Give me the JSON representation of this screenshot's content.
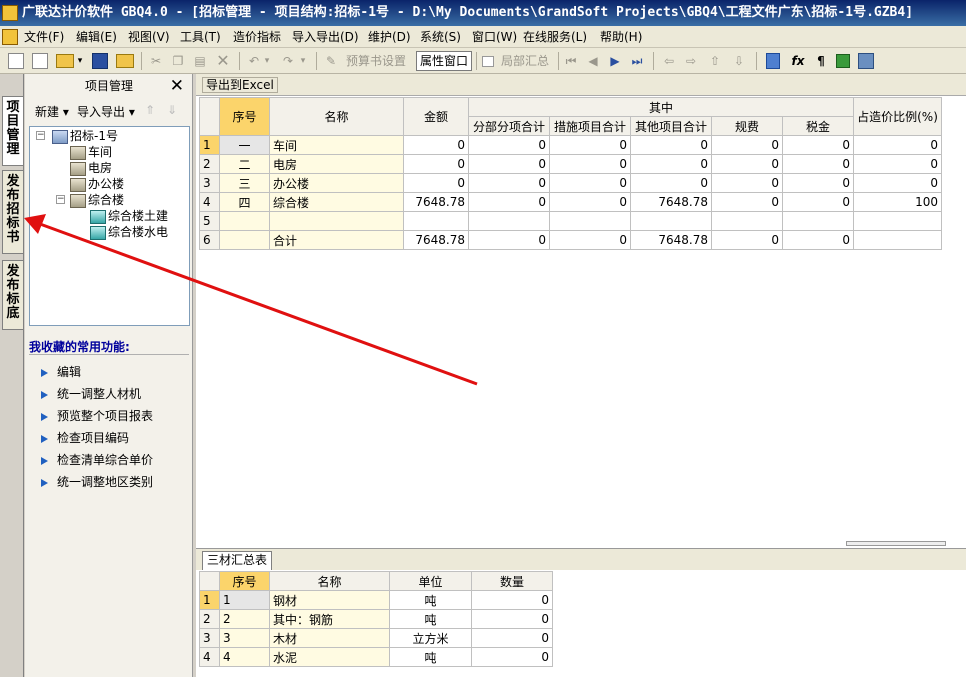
{
  "window": {
    "title": "广联达计价软件 GBQ4.0 - [招标管理 - 项目结构:招标-1号 - D:\\My Documents\\GrandSoft Projects\\GBQ4\\工程文件广东\\招标-1号.GZB4]"
  },
  "menu": {
    "items": [
      {
        "label": "文件(F)"
      },
      {
        "label": "编辑(E)"
      },
      {
        "label": "视图(V)"
      },
      {
        "label": "工具(T)"
      },
      {
        "label": "造价指标"
      },
      {
        "label": "导入导出(D)"
      },
      {
        "label": "维护(D)"
      },
      {
        "label": "系统(S)"
      },
      {
        "label": "窗口(W)"
      },
      {
        "label": "在线服务(L)"
      },
      {
        "label": "帮助(H)"
      }
    ]
  },
  "toolbar": {
    "budget_settings": "预算书设置",
    "properties_window": "属性窗口",
    "partial_summary": "局部汇总",
    "fx": "fx",
    "pilcrow": "¶"
  },
  "side_tabs": [
    {
      "label": "项目管理"
    },
    {
      "label": "发布招标书"
    },
    {
      "label": "发布标底"
    }
  ],
  "panel": {
    "title": "项目管理",
    "close": "✕",
    "new": "新建 ▾",
    "import_export": "导入导出 ▾",
    "up": "⇑",
    "down": "⇓"
  },
  "tree": {
    "root": "招标-1号",
    "nodes": [
      "车间",
      "电房",
      "办公楼",
      "综合楼"
    ],
    "subnodes": [
      "综合楼土建",
      "综合楼水电"
    ]
  },
  "favorites": {
    "title": "我收藏的常用功能:",
    "items": [
      "编辑",
      "统一调整人材机",
      "预览整个项目报表",
      "检查项目编码",
      "检查清单综合单价",
      "统一调整地区类别"
    ]
  },
  "export_button": "导出到Excel",
  "project_table": {
    "headers": {
      "seq": "序号",
      "name": "名称",
      "amount": "金额",
      "group": "其中",
      "sub": [
        "分部分项合计",
        "措施项目合计",
        "其他项目合计",
        "规费",
        "税金"
      ],
      "ratio": "占造价比例(%)"
    },
    "rows": [
      {
        "rn": "1",
        "seq": "一",
        "name": "车间",
        "amount": "0",
        "c1": "0",
        "c2": "0",
        "c3": "0",
        "c4": "0",
        "c5": "0",
        "ratio": "0"
      },
      {
        "rn": "2",
        "seq": "二",
        "name": "电房",
        "amount": "0",
        "c1": "0",
        "c2": "0",
        "c3": "0",
        "c4": "0",
        "c5": "0",
        "ratio": "0"
      },
      {
        "rn": "3",
        "seq": "三",
        "name": "办公楼",
        "amount": "0",
        "c1": "0",
        "c2": "0",
        "c3": "0",
        "c4": "0",
        "c5": "0",
        "ratio": "0"
      },
      {
        "rn": "4",
        "seq": "四",
        "name": "综合楼",
        "amount": "7648.78",
        "c1": "0",
        "c2": "0",
        "c3": "7648.78",
        "c4": "0",
        "c5": "0",
        "ratio": "100"
      },
      {
        "rn": "5",
        "seq": "",
        "name": "",
        "amount": "",
        "c1": "",
        "c2": "",
        "c3": "",
        "c4": "",
        "c5": "",
        "ratio": ""
      },
      {
        "rn": "6",
        "seq": "",
        "name": "合计",
        "amount": "7648.78",
        "c1": "0",
        "c2": "0",
        "c3": "7648.78",
        "c4": "0",
        "c5": "0",
        "ratio": ""
      }
    ]
  },
  "materials_tab": "三材汇总表",
  "materials_table": {
    "headers": [
      "序号",
      "名称",
      "单位",
      "数量"
    ],
    "rows": [
      {
        "rn": "1",
        "seq": "1",
        "name": "钢材",
        "unit": "吨",
        "qty": "0"
      },
      {
        "rn": "2",
        "seq": "2",
        "name": "其中：钢筋",
        "unit": "吨",
        "qty": "0"
      },
      {
        "rn": "3",
        "seq": "3",
        "name": "木材",
        "unit": "立方米",
        "qty": "0"
      },
      {
        "rn": "4",
        "seq": "4",
        "name": "水泥",
        "unit": "吨",
        "qty": "0"
      }
    ]
  },
  "colors": {
    "title_bar": "#0a246a",
    "header_highlight": "#fbd46b",
    "row_bg": "#fffbe2",
    "annotation_arrow": "#e01010"
  }
}
